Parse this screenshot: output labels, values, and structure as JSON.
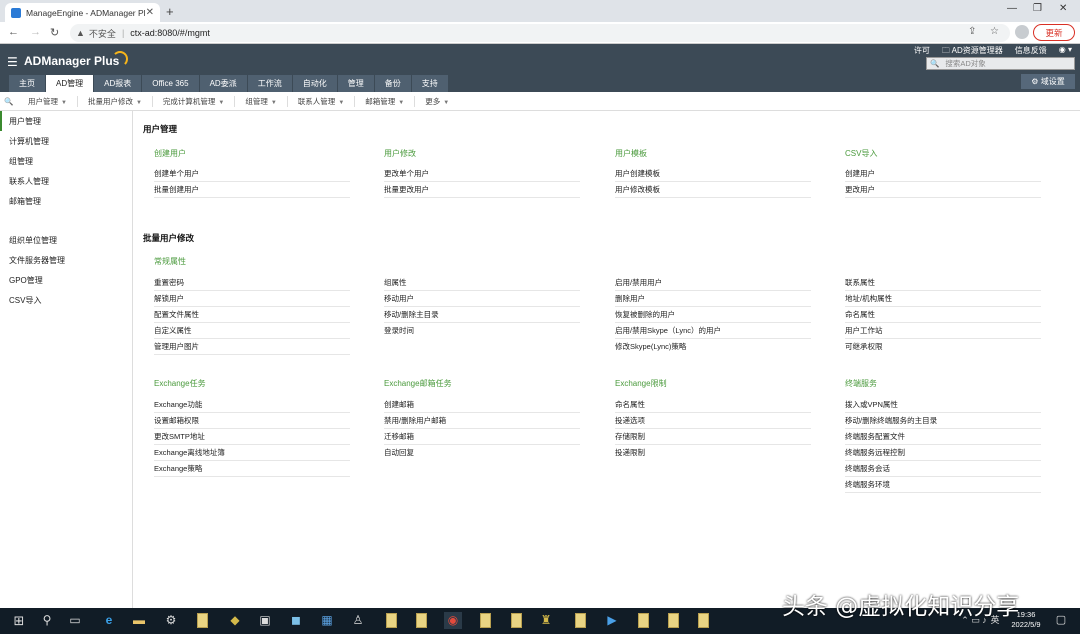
{
  "browser": {
    "tab_title": "ManageEngine - ADManager Plus",
    "new_tab": "+",
    "unsafe": "不安全",
    "url": "ctx-ad:8080/#/mgmt",
    "update_label": "更新"
  },
  "app": {
    "brand": "ADManager Plus",
    "top_links": [
      "许可",
      "AD资源管理器",
      "信息反馈"
    ],
    "search_placeholder": "搜索AD对象",
    "tabs": [
      "主页",
      "AD管理",
      "AD报表",
      "Office 365",
      "AD委派",
      "工作流",
      "自动化",
      "管理",
      "备份",
      "支持"
    ],
    "active_tab": "AD管理",
    "domain_settings": "域设置"
  },
  "submenu": [
    "用户管理",
    "批量用户修改",
    "完成计算机管理",
    "组管理",
    "联系人管理",
    "邮箱管理",
    "更多"
  ],
  "sidebar": {
    "items": [
      "用户管理",
      "计算机管理",
      "组管理",
      "联系人管理",
      "邮箱管理"
    ],
    "items2": [
      "组织单位管理",
      "文件服务器管理",
      "GPO管理",
      "CSV导入"
    ]
  },
  "main": {
    "section1": {
      "title": "用户管理",
      "groups": [
        {
          "title": "创建用户",
          "links": [
            "创建单个用户",
            "批量创建用户"
          ]
        },
        {
          "title": "用户修改",
          "links": [
            "更改单个用户",
            "批量更改用户"
          ]
        },
        {
          "title": "用户模板",
          "links": [
            "用户创建模板",
            "用户修改模板"
          ]
        },
        {
          "title": "CSV导入",
          "links": [
            "创建用户",
            "更改用户"
          ]
        }
      ]
    },
    "section2": {
      "title": "批量用户修改",
      "common_title": "常规属性",
      "col1": [
        "重置密码",
        "解锁用户",
        "配置文件属性",
        "自定义属性",
        "管理用户图片"
      ],
      "col2": [
        "组属性",
        "移动用户",
        "移动/删除主目录",
        "登录时间"
      ],
      "col3": [
        "启用/禁用用户",
        "删除用户",
        "恢复被删除的用户",
        "启用/禁用Skype（Lync）的用户",
        "修改Skype(Lync)策略"
      ],
      "col4": [
        "联系属性",
        "地址/机构属性",
        "命名属性",
        "用户工作站",
        "可继承权限"
      ]
    },
    "section3": {
      "groups": [
        {
          "title": "Exchange任务",
          "links": [
            "Exchange功能",
            "设置邮箱权限",
            "更改SMTP地址",
            "Exchange离线地址簿",
            "Exchange策略"
          ]
        },
        {
          "title": "Exchange邮箱任务",
          "links": [
            "创建邮箱",
            "禁用/删除用户邮箱",
            "迁移邮箱",
            "自动回复"
          ]
        },
        {
          "title": "Exchange限制",
          "links": [
            "命名属性",
            "投递选项",
            "存储限制",
            "投递限制"
          ]
        },
        {
          "title": "终端服务",
          "links": [
            "拨入或VPN属性",
            "移动/删除终端服务的主目录",
            "终端服务配置文件",
            "终端服务远程控制",
            "终端服务会话",
            "终端服务环境"
          ]
        }
      ]
    }
  },
  "taskbar": {
    "time": "19:36",
    "date": "2022/5/9",
    "lang": "英"
  },
  "watermark": "头条 @虚拟化知识分享"
}
